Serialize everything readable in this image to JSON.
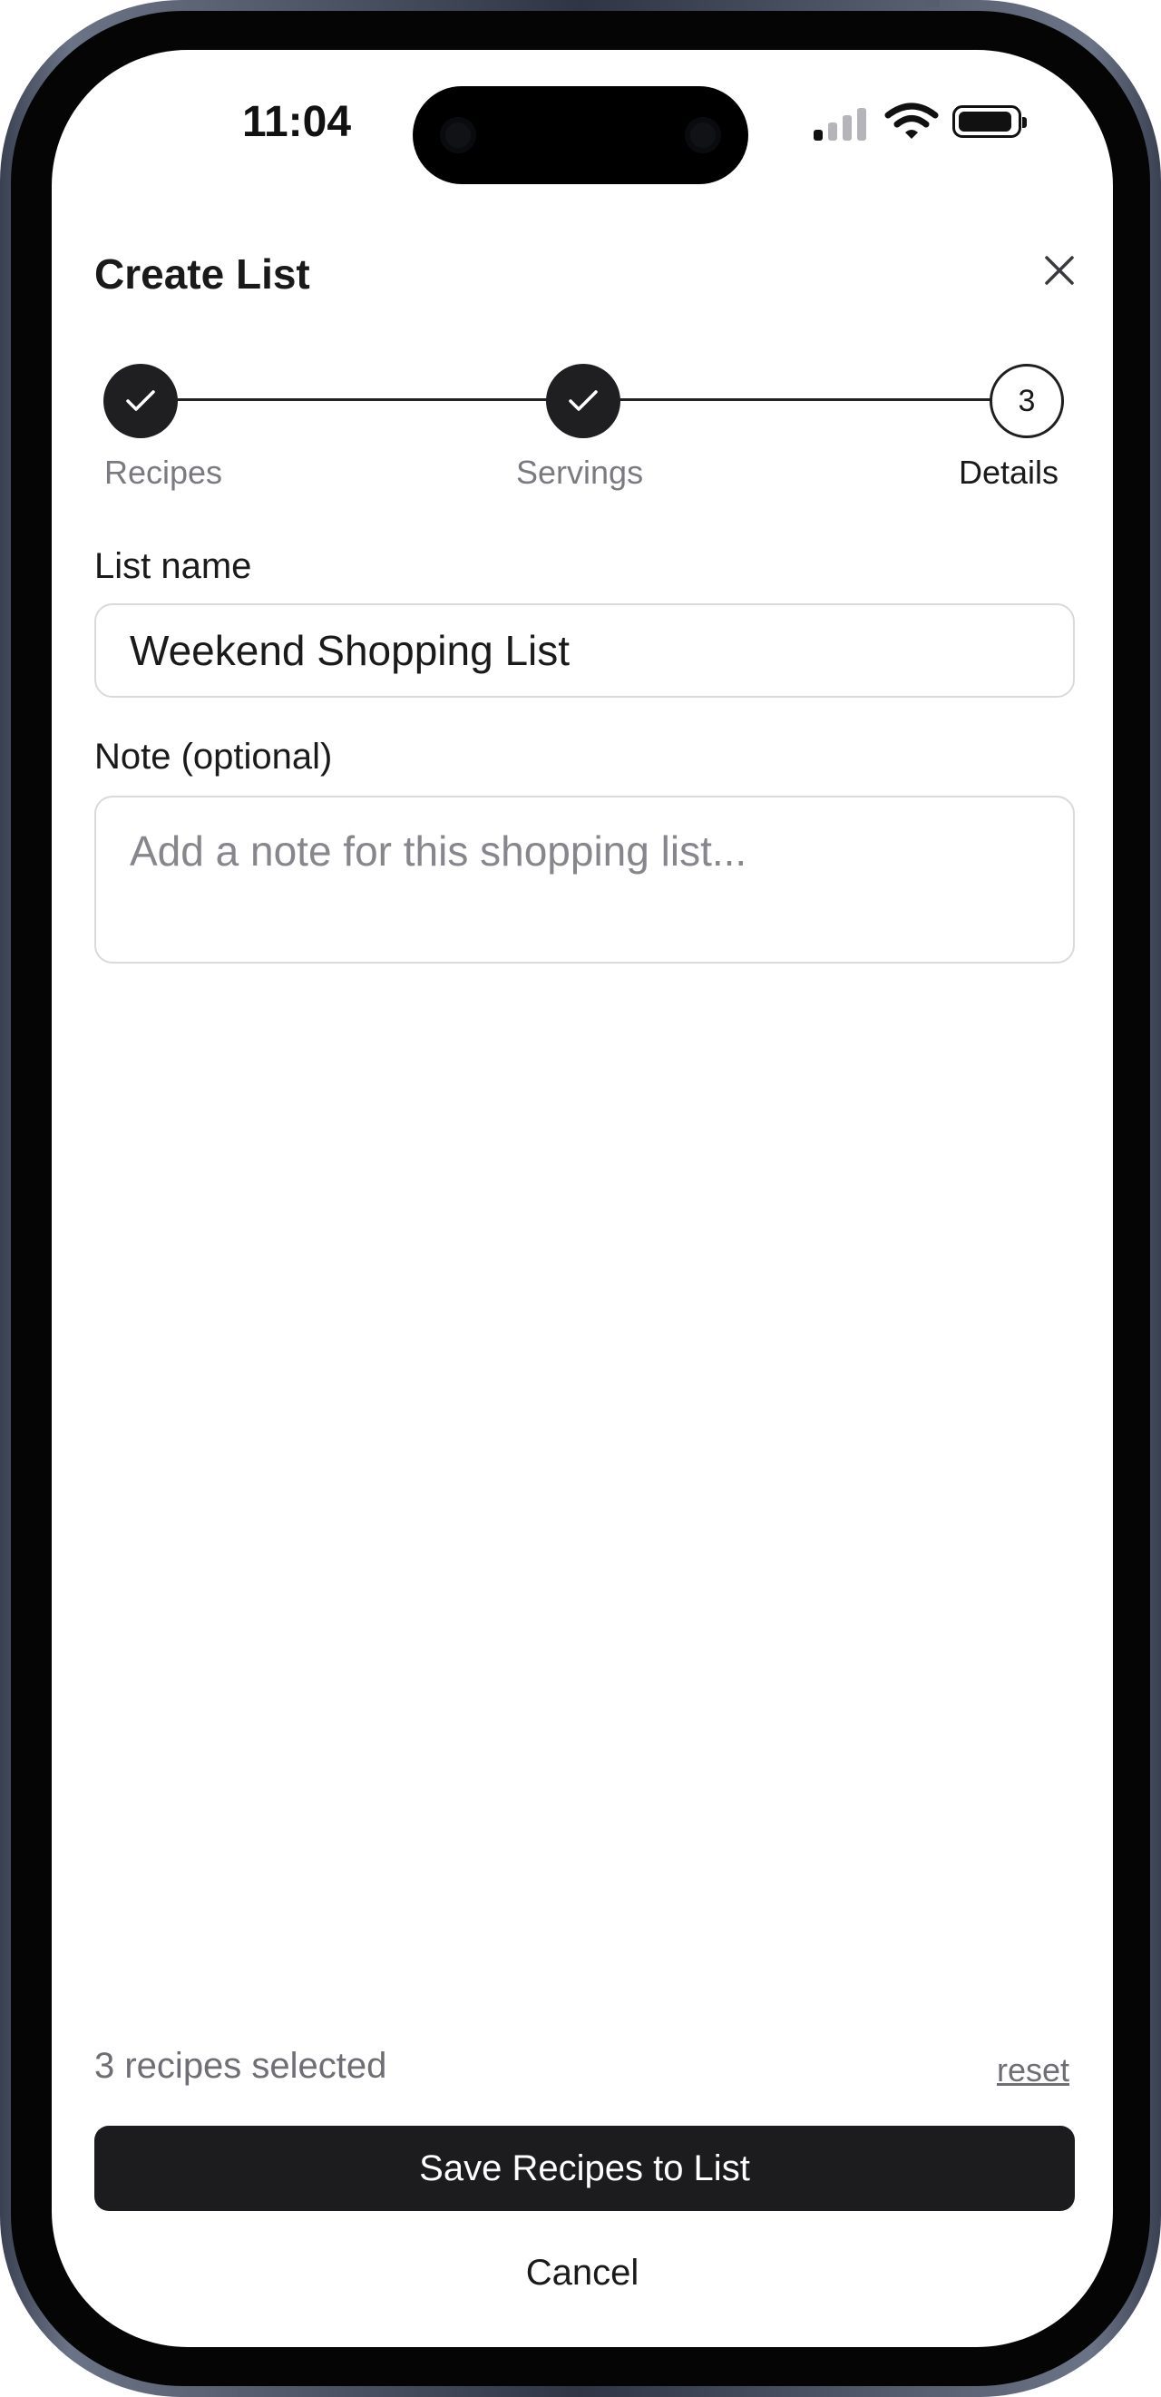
{
  "status_bar": {
    "time": "11:04",
    "icons": [
      "cellular-signal-icon",
      "wifi-icon",
      "battery-icon"
    ]
  },
  "header": {
    "title": "Create List",
    "close_icon": "close-icon"
  },
  "stepper": {
    "steps": [
      {
        "label": "Recipes",
        "state": "completed",
        "icon": "checkmark-icon"
      },
      {
        "label": "Servings",
        "state": "completed",
        "icon": "checkmark-icon"
      },
      {
        "label": "Details",
        "state": "current",
        "number": "3"
      }
    ]
  },
  "form": {
    "list_name": {
      "label": "List name",
      "value": "Weekend Shopping List"
    },
    "note": {
      "label": "Note (optional)",
      "value": "",
      "placeholder": "Add a note for this shopping list..."
    }
  },
  "footer": {
    "selected_count": "3 recipes selected",
    "reset_label": "reset",
    "save_label": "Save Recipes to List",
    "cancel_label": "Cancel"
  },
  "colors": {
    "primary": "#1c1c1f",
    "muted_text": "#6e6e74",
    "border": "#d9d9de"
  }
}
